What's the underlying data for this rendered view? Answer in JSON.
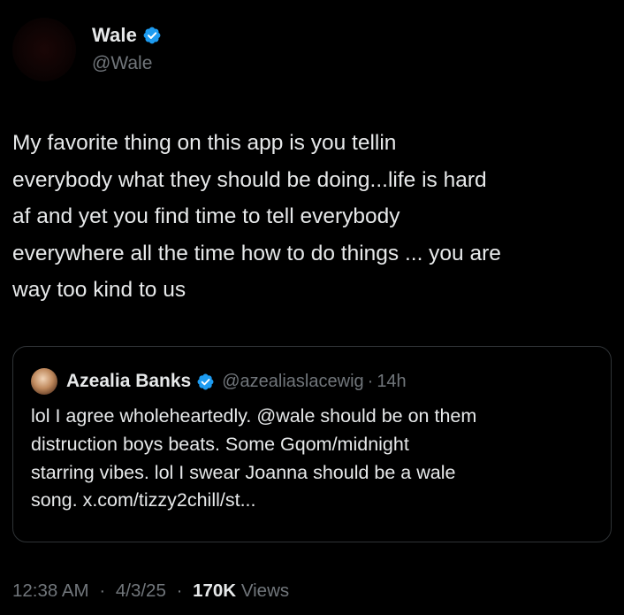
{
  "tweet": {
    "author_name": "Wale",
    "author_handle": "@Wale",
    "text": "My favorite thing on this app is you tellin\neverybody what they should be doing...life is hard\naf and yet you find time to tell everybody\neverywhere all the time how to do things ... you are\nway too kind to us",
    "time": "12:38 AM",
    "date": "4/3/25",
    "separator": "·",
    "views_count": "170K",
    "views_label": "Views"
  },
  "quote": {
    "author_name": "Azealia Banks",
    "author_handle": "@azealiaslacewig",
    "separator": "·",
    "time_ago": "14h",
    "text": "lol I agree wholeheartedly. @wale should be on them\ndistruction boys beats. Some Gqom/midnight\nstarring vibes. lol I swear Joanna should be a wale\nsong. x.com/tizzy2chill/st..."
  },
  "colors": {
    "background": "#000000",
    "text_primary": "#e7e9ea",
    "text_secondary": "#71767b",
    "verified_badge": "#1d9bf0",
    "border": "#2f3336"
  },
  "icons": {
    "verified": "verified-badge-icon"
  }
}
